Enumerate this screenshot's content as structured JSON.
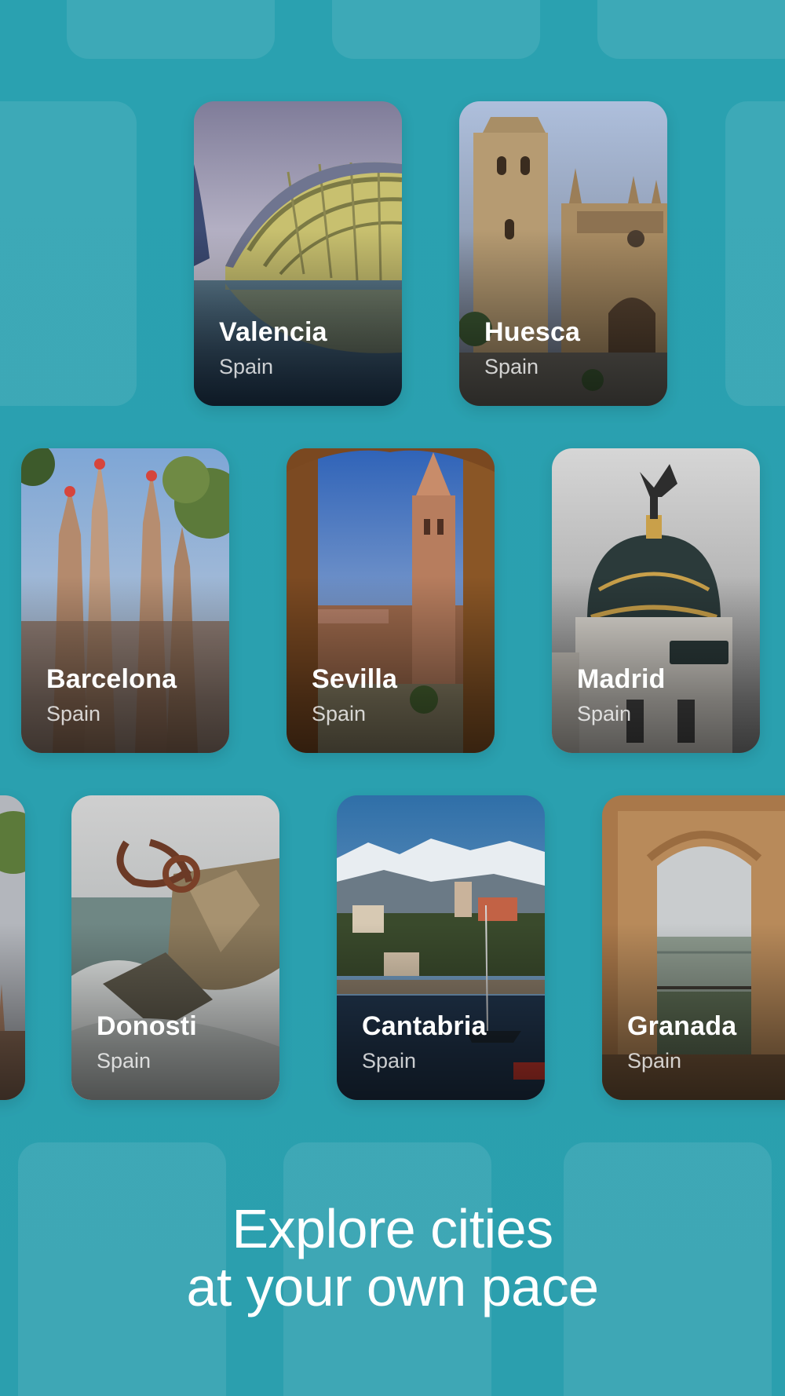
{
  "headline": {
    "line1": "Explore cities",
    "line2": "at your own pace"
  },
  "cards": {
    "valencia": {
      "city": "Valencia",
      "country": "Spain"
    },
    "huesca": {
      "city": "Huesca",
      "country": "Spain"
    },
    "barcelona": {
      "city": "Barcelona",
      "country": "Spain"
    },
    "sevilla": {
      "city": "Sevilla",
      "country": "Spain"
    },
    "madrid": {
      "city": "Madrid",
      "country": "Spain"
    },
    "donosti": {
      "city": "Donosti",
      "country": "Spain"
    },
    "cantabria": {
      "city": "Cantabria",
      "country": "Spain"
    },
    "granada": {
      "city": "Granada",
      "country": "Spain"
    }
  },
  "colors": {
    "background": "#2aa1b0",
    "text": "#ffffff"
  }
}
